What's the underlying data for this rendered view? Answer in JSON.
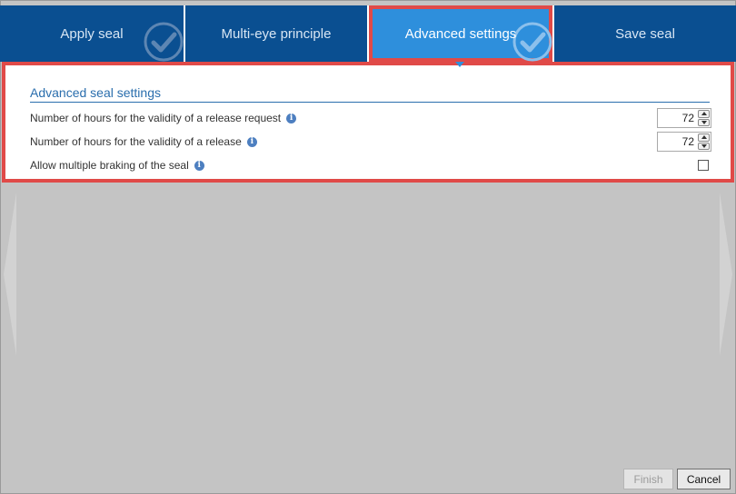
{
  "wizard": {
    "tabs": [
      {
        "label": "Apply seal",
        "completed": true,
        "active": false
      },
      {
        "label": "Multi-eye principle",
        "completed": false,
        "active": false
      },
      {
        "label": "Advanced settings",
        "completed": true,
        "active": true
      },
      {
        "label": "Save seal",
        "completed": false,
        "active": false
      }
    ]
  },
  "panel": {
    "title": "Advanced seal settings",
    "rows": [
      {
        "label": "Number of hours for the validity of a release request",
        "value": "72",
        "control": "spinner",
        "info_icon": "info-icon"
      },
      {
        "label": "Number of hours for the validity of a release",
        "value": "72",
        "control": "spinner",
        "info_icon": "info-icon"
      },
      {
        "label": "Allow multiple braking of the seal",
        "checked": false,
        "control": "checkbox",
        "info_icon": "info-icon"
      }
    ]
  },
  "footer": {
    "finish_label": "Finish",
    "finish_enabled": false,
    "cancel_label": "Cancel"
  },
  "colors": {
    "tab_background": "#0a4f91",
    "tab_active": "#2e8fdc",
    "highlight_border": "#e04a48",
    "section_title": "#2a6ead",
    "canvas": "#c4c4c4"
  },
  "icons": {
    "tab_check": "checkmark-circle-icon",
    "nav_prev": "chevron-left-icon",
    "nav_next": "chevron-right-icon"
  }
}
